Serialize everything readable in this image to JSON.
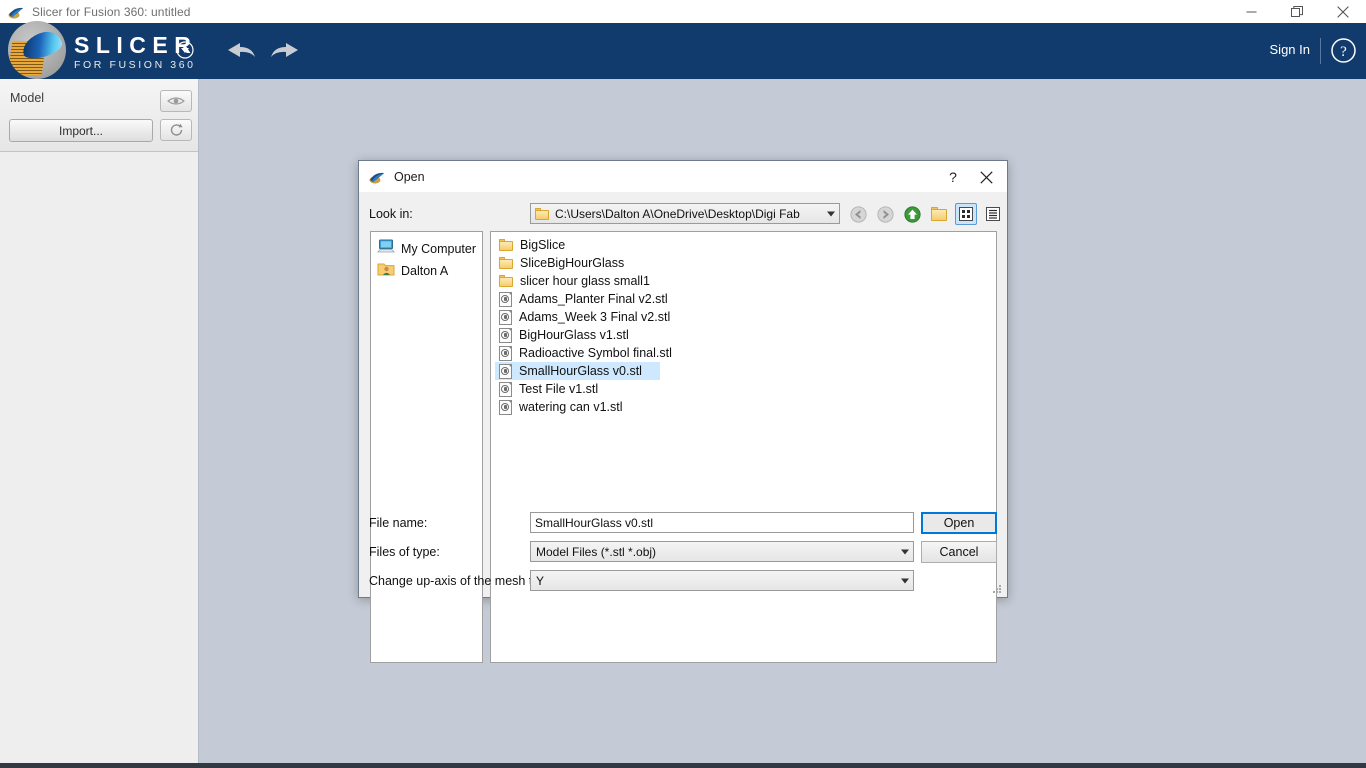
{
  "window": {
    "title": "Slicer for Fusion 360: untitled",
    "app_icon": "slicer-app-icon",
    "controls": [
      {
        "name": "minimize",
        "glyph": "minimize-icon"
      },
      {
        "name": "maximize",
        "glyph": "restore-icon"
      },
      {
        "name": "close",
        "glyph": "close-icon"
      }
    ]
  },
  "header": {
    "brand_line1": "SLICER",
    "brand_line2": "FOR FUSION 360",
    "caret_icon": "chevron-down-circle-icon",
    "undo_icon": "undo-arrow-icon",
    "redo_icon": "redo-arrow-icon",
    "sign_in": "Sign In",
    "help_icon": "help-circle-icon",
    "background": "#123b6d"
  },
  "left_panel": {
    "section_title": "Model",
    "import_label": "Import...",
    "visibility_icon": "eye-icon",
    "refresh_icon": "refresh-icon"
  },
  "canvas": {
    "background": "#c5cbd6"
  },
  "dialog": {
    "title": "Open",
    "icon": "slicer-app-icon",
    "help_label": "?",
    "close_label": "✕",
    "lookin_label": "Look in:",
    "lookin_value": "C:\\Users\\Dalton A\\OneDrive\\Desktop\\Digi Fab",
    "nav_buttons": [
      {
        "name": "back-button",
        "icon": "back-arrow-icon",
        "enabled": false
      },
      {
        "name": "forward-button",
        "icon": "forward-arrow-icon",
        "enabled": false
      },
      {
        "name": "parent-directory-button",
        "icon": "up-arrow-icon",
        "enabled": true
      },
      {
        "name": "new-folder-button",
        "icon": "new-folder-icon",
        "enabled": true
      },
      {
        "name": "list-view-button",
        "icon": "list-view-icon",
        "selected": true
      },
      {
        "name": "detail-view-button",
        "icon": "detail-view-icon",
        "selected": false
      }
    ],
    "places": [
      {
        "label": "My Computer",
        "icon": "computer-icon"
      },
      {
        "label": "Dalton A",
        "icon": "user-folder-icon"
      }
    ],
    "files": [
      {
        "name": "BigSlice",
        "type": "folder",
        "selected": false
      },
      {
        "name": "SliceBigHourGlass",
        "type": "folder",
        "selected": false
      },
      {
        "name": "slicer hour glass small1",
        "type": "folder",
        "selected": false
      },
      {
        "name": "Adams_Planter Final v2.stl",
        "type": "file",
        "selected": false
      },
      {
        "name": "Adams_Week 3 Final v2.stl",
        "type": "file",
        "selected": false
      },
      {
        "name": "BigHourGlass v1.stl",
        "type": "file",
        "selected": false
      },
      {
        "name": "Radioactive Symbol final.stl",
        "type": "file",
        "selected": false
      },
      {
        "name": "SmallHourGlass v0.stl",
        "type": "file",
        "selected": true
      },
      {
        "name": "Test File v1.stl",
        "type": "file",
        "selected": false
      },
      {
        "name": "watering can v1.stl",
        "type": "file",
        "selected": false
      }
    ],
    "filename_label": "File name:",
    "filename_value": "SmallHourGlass v0.stl",
    "filetype_label": "Files of type:",
    "filetype_value": "Model Files (*.stl *.obj)",
    "upaxis_label": "Change up-axis of the mesh to:",
    "upaxis_value": "Y",
    "open_button": "Open",
    "cancel_button": "Cancel",
    "accent": "#0078d7",
    "selection_color": "#cde8ff"
  }
}
